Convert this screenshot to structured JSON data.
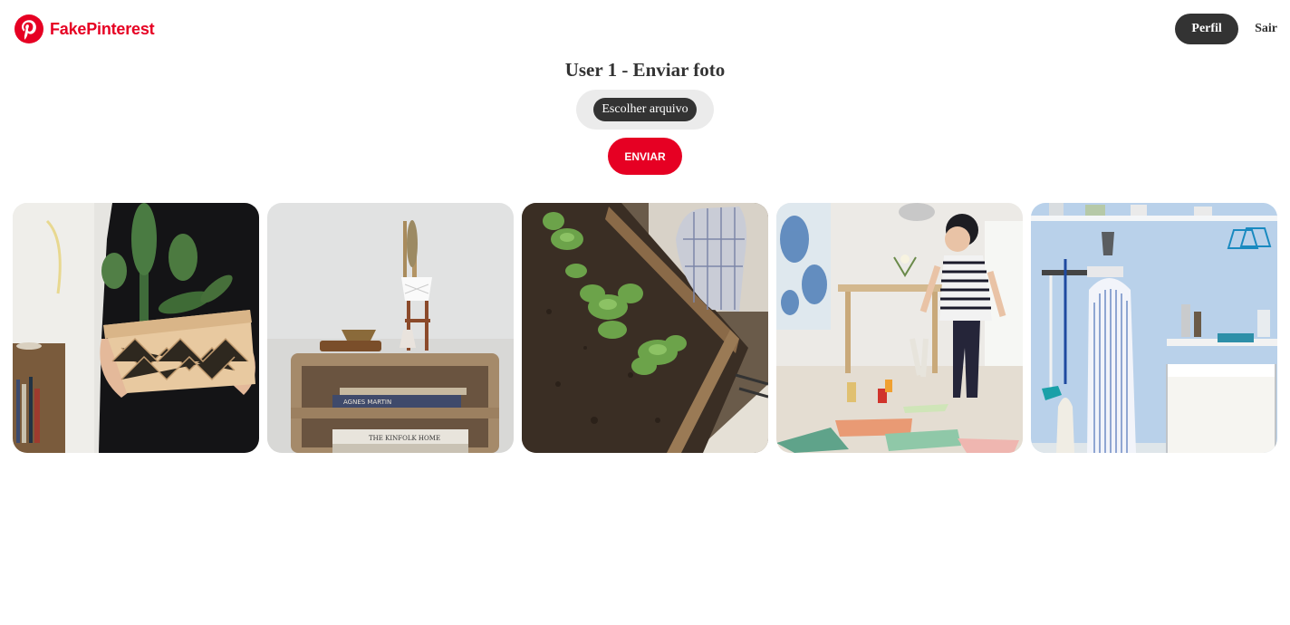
{
  "navbar": {
    "brand_name": "FakePinterest",
    "logo_icon": "pinterest-logo-icon",
    "profile_label": "Perfil",
    "logout_label": "Sair"
  },
  "main": {
    "title": "User 1 - Enviar foto",
    "file_button_label": "Escolher arquivo",
    "submit_label": "ENVIAR"
  },
  "colors": {
    "brand_red": "#e60023",
    "dark": "#333333",
    "pill_bg": "#ebebeb"
  },
  "photos": [
    {
      "subject": "person holding cactus in woven basket"
    },
    {
      "subject": "wooden crate shelf with books and small cactus"
    },
    {
      "subject": "gloved hand planting lettuce seedlings in wooden crate"
    },
    {
      "subject": "child with striped shirt in bright room with drawings"
    },
    {
      "subject": "blue laundry wall with ironing board and mop"
    }
  ],
  "book_spines": [
    "AGNES MARTIN",
    "THE KINFOLK HOME"
  ]
}
